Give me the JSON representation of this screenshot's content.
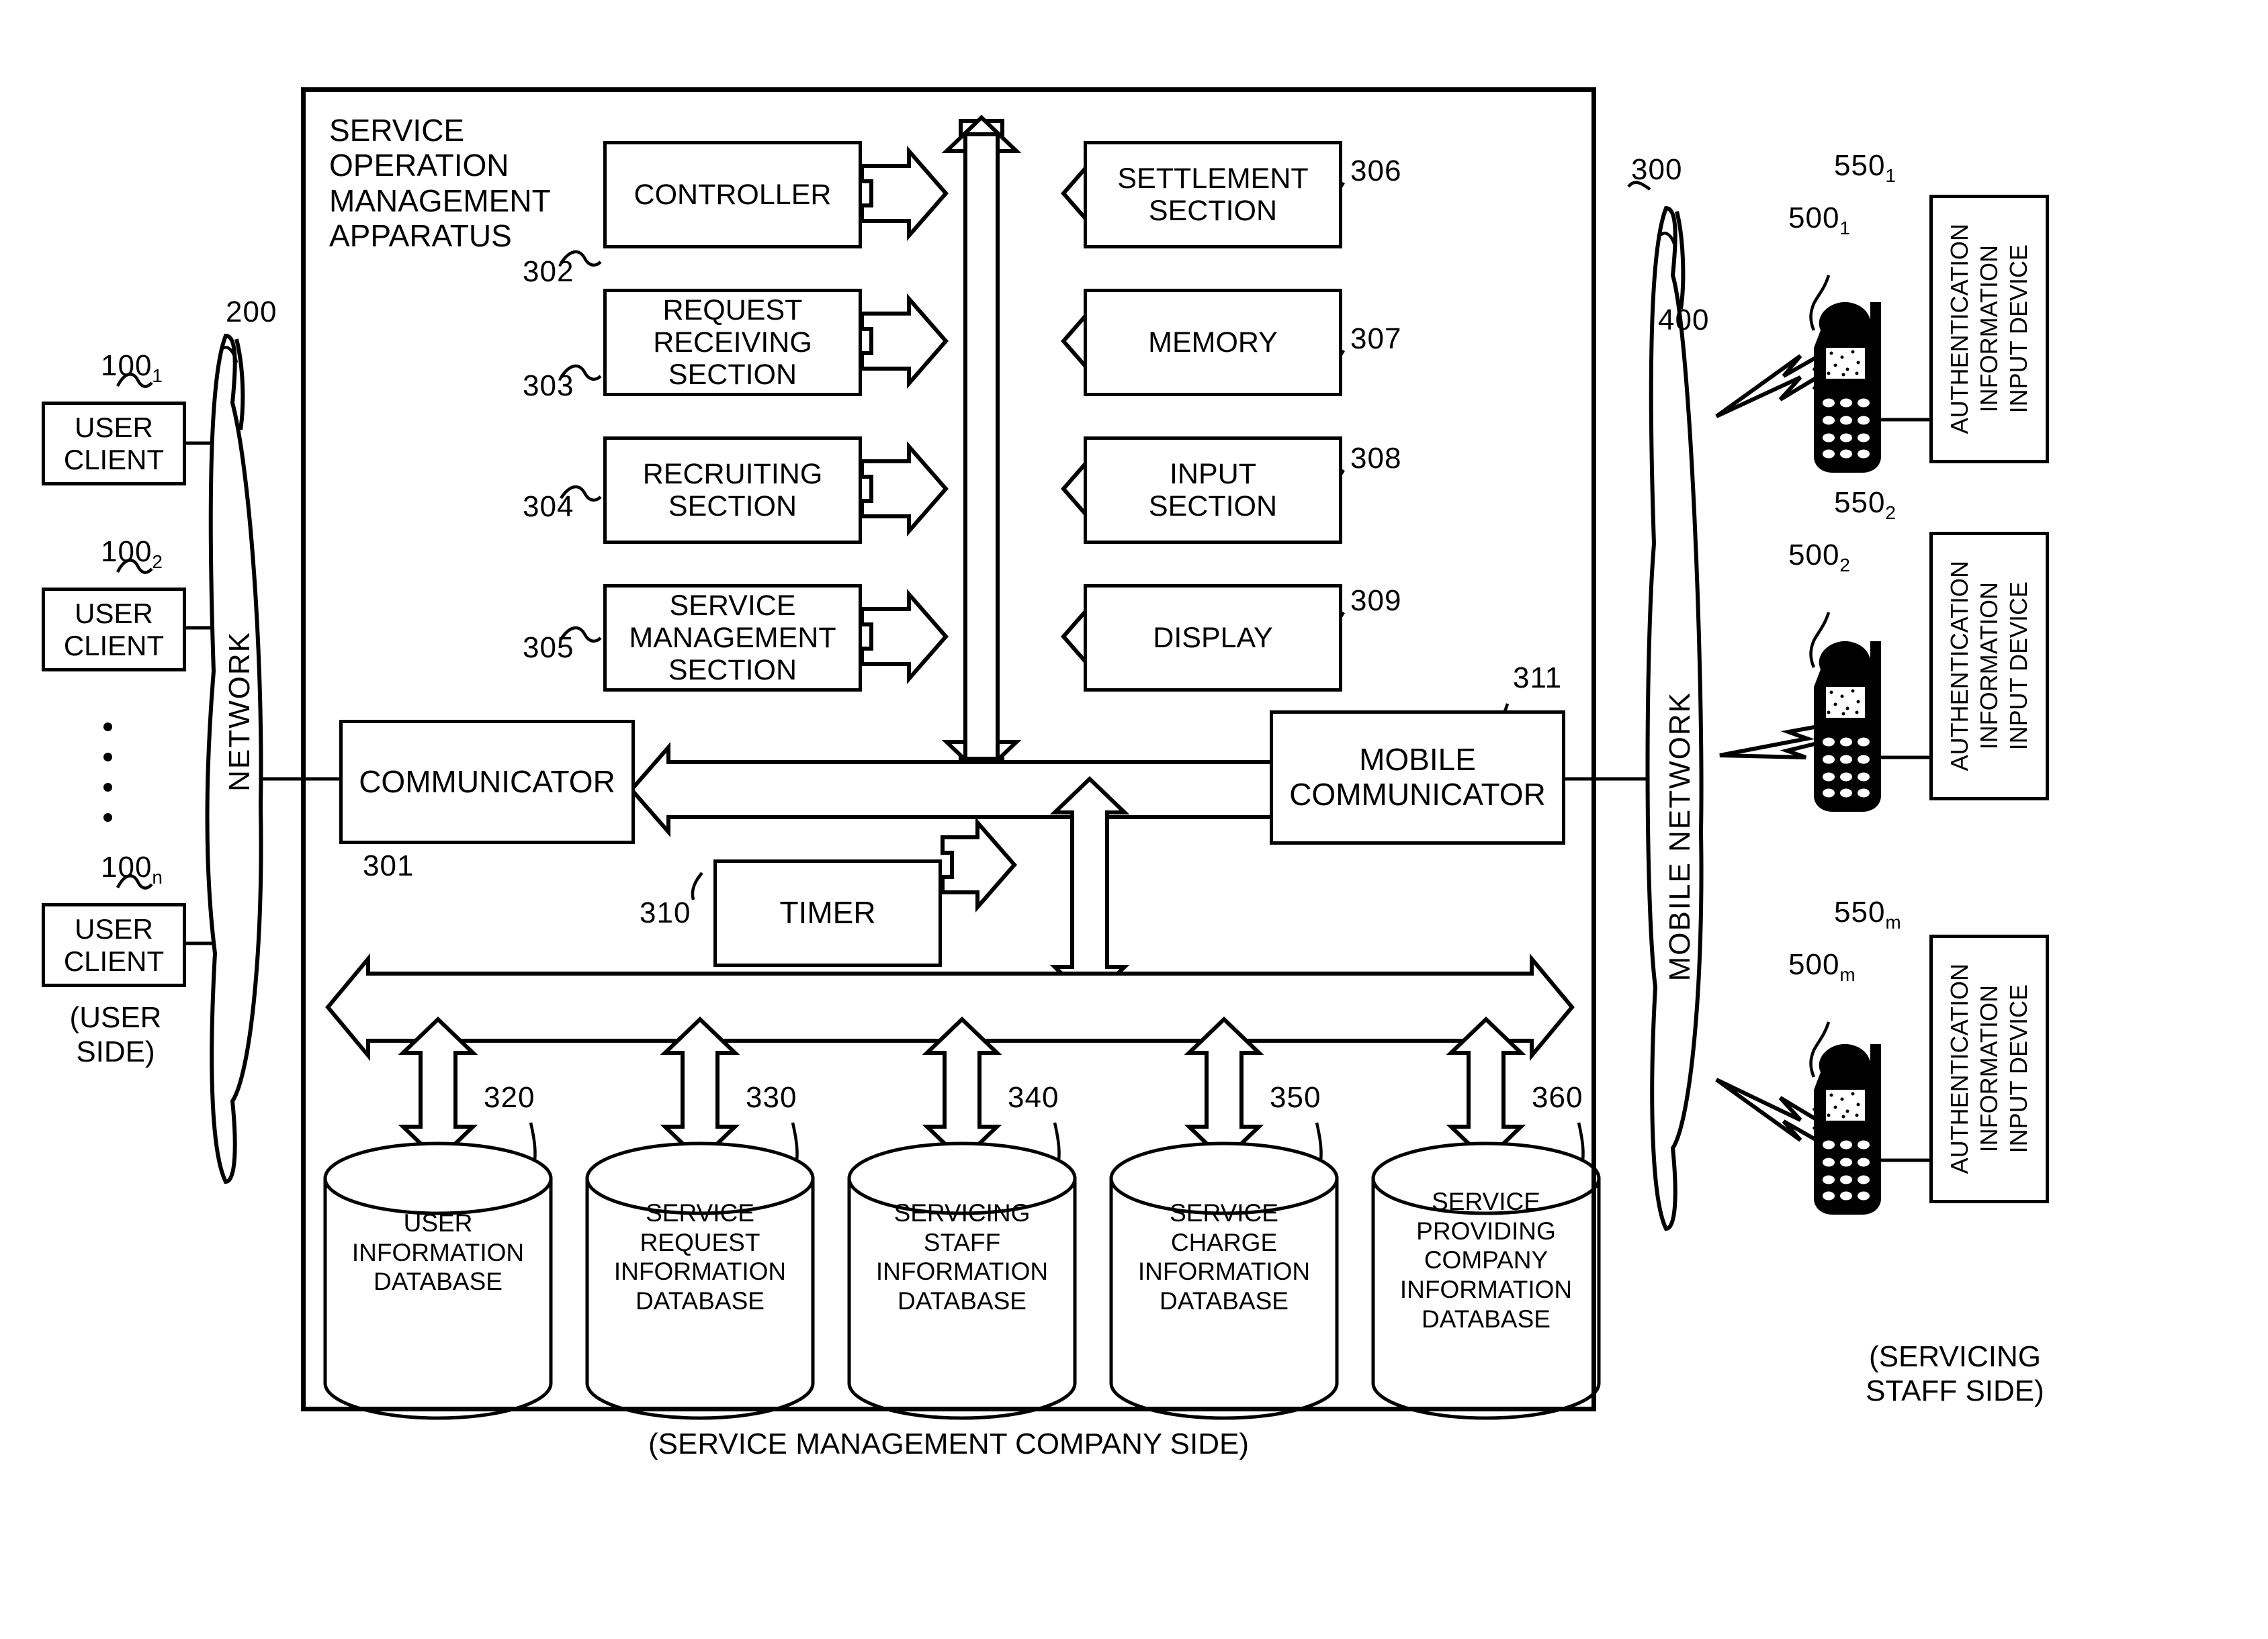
{
  "figure": {
    "apparatus_title": "SERVICE\nOPERATION\nMANAGEMENT\nAPPARATUS",
    "apparatus_ref": "300",
    "bottom_caption": "(SERVICE MANAGEMENT COMPANY SIDE)",
    "user_side_caption": "(USER\nSIDE)",
    "staff_side_caption": "(SERVICING\nSTAFF SIDE)"
  },
  "user_clients": [
    {
      "label": "USER\nCLIENT",
      "ref": "100",
      "sub": "1"
    },
    {
      "label": "USER\nCLIENT",
      "ref": "100",
      "sub": "2"
    },
    {
      "label": "USER\nCLIENT",
      "ref": "100",
      "sub": "n"
    }
  ],
  "networks": {
    "user_network": {
      "label": "NETWORK",
      "ref": "200"
    },
    "mobile_network": {
      "label": "MOBILE NETWORK",
      "ref": "400"
    }
  },
  "left_modules": [
    {
      "label": "CONTROLLER",
      "ref": "302"
    },
    {
      "label": "REQUEST\nRECEIVING\nSECTION",
      "ref": "303"
    },
    {
      "label": "RECRUITING\nSECTION",
      "ref": "304"
    },
    {
      "label": "SERVICE\nMANAGEMENT\nSECTION",
      "ref": "305"
    }
  ],
  "right_modules": [
    {
      "label": "SETTLEMENT\nSECTION",
      "ref": "306"
    },
    {
      "label": "MEMORY",
      "ref": "307"
    },
    {
      "label": "INPUT\nSECTION",
      "ref": "308"
    },
    {
      "label": "DISPLAY",
      "ref": "309"
    }
  ],
  "communicators": {
    "communicator": {
      "label": "COMMUNICATOR",
      "ref": "301"
    },
    "mobile_communicator": {
      "label": "MOBILE\nCOMMUNICATOR",
      "ref": "311"
    },
    "timer": {
      "label": "TIMER",
      "ref": "310"
    }
  },
  "databases": [
    {
      "label": "USER\nINFORMATION\nDATABASE",
      "ref": "320"
    },
    {
      "label": "SERVICE\nREQUEST\nINFORMATION\nDATABASE",
      "ref": "330"
    },
    {
      "label": "SERVICING\nSTAFF\nINFORMATION\nDATABASE",
      "ref": "340"
    },
    {
      "label": "SERVICE\nCHARGE\nINFORMATION\nDATABASE",
      "ref": "350"
    },
    {
      "label": "SERVICE\nPROVIDING\nCOMPANY\nINFORMATION\nDATABASE",
      "ref": "360"
    }
  ],
  "mobile_terminals": [
    {
      "ref": "500",
      "sub": "1",
      "device_label": "AUTHENTICATION\nINFORMATION\nINPUT DEVICE",
      "device_ref": "550",
      "device_sub": "1"
    },
    {
      "ref": "500",
      "sub": "2",
      "device_label": "AUTHENTICATION\nINFORMATION\nINPUT DEVICE",
      "device_ref": "550",
      "device_sub": "2"
    },
    {
      "ref": "500",
      "sub": "m",
      "device_label": "AUTHENTICATION\nINFORMATION\nINPUT DEVICE",
      "device_ref": "550",
      "device_sub": "m"
    }
  ],
  "colors": {
    "ink": "#000000",
    "paper": "#ffffff"
  }
}
